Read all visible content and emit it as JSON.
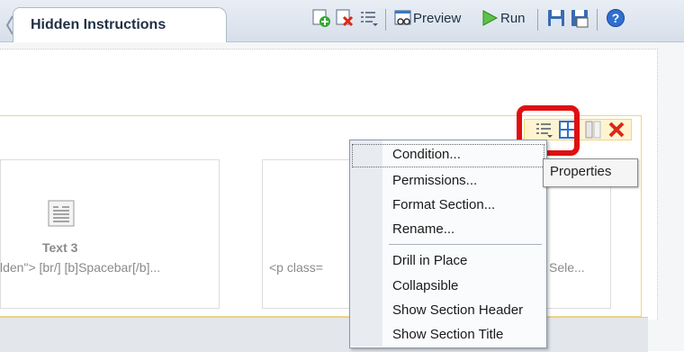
{
  "tab": {
    "title": "Hidden Instructions"
  },
  "toolbar": {
    "preview_label": "Preview",
    "run_label": "Run"
  },
  "cards": [
    {
      "title": "Text 3",
      "snippet": "lden\"> [br/] [b]Spacebar[/b]..."
    },
    {
      "snippet": "<p class="
    },
    {
      "snippet": "Sele..."
    }
  ],
  "tooltip": "Properties",
  "context_menu": {
    "items": [
      "Condition...",
      "Permissions...",
      "Format Section...",
      "Rename..."
    ],
    "items2": [
      "Drill in Place",
      "Collapsible",
      "Show Section Header",
      "Show Section Title"
    ],
    "selected": "Condition..."
  },
  "colors": {
    "highlight": "#e01010",
    "section_border": "#f0d77a"
  }
}
